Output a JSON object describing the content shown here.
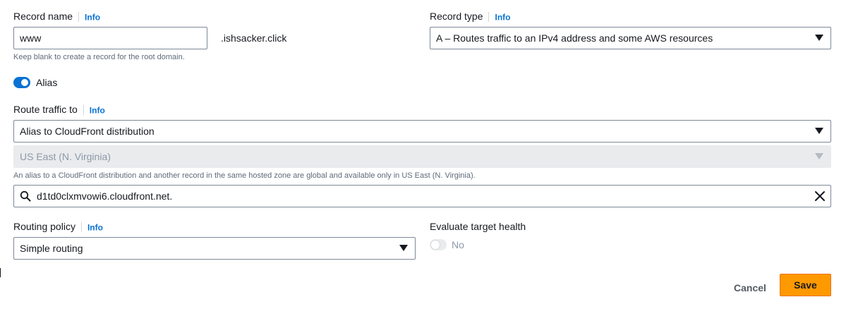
{
  "record_name": {
    "label": "Record name",
    "info": "Info",
    "value": "www",
    "domain_suffix": ".ishsacker.click",
    "hint": "Keep blank to create a record for the root domain."
  },
  "record_type": {
    "label": "Record type",
    "info": "Info",
    "selected": "A – Routes traffic to an IPv4 address and some AWS resources"
  },
  "alias": {
    "label": "Alias",
    "enabled": true
  },
  "route_traffic": {
    "label": "Route traffic to",
    "info": "Info",
    "endpoint_type": "Alias to CloudFront distribution",
    "region": "US East (N. Virginia)",
    "region_hint": "An alias to a CloudFront distribution and another record in the same hosted zone are global and available only in US East (N. Virginia).",
    "target_value": "d1td0clxmvowi6.cloudfront.net."
  },
  "routing_policy": {
    "label": "Routing policy",
    "info": "Info",
    "selected": "Simple routing"
  },
  "evaluate_target_health": {
    "label": "Evaluate target health",
    "state_label": "No",
    "enabled": false
  },
  "actions": {
    "cancel": "Cancel",
    "save": "Save"
  },
  "colors": {
    "link": "#0972d3",
    "toggle_on": "#0972d3",
    "primary_button": "#ff9900"
  },
  "icons": {
    "search": "search-icon",
    "clear": "close-icon",
    "caret": "caret-down-icon"
  }
}
